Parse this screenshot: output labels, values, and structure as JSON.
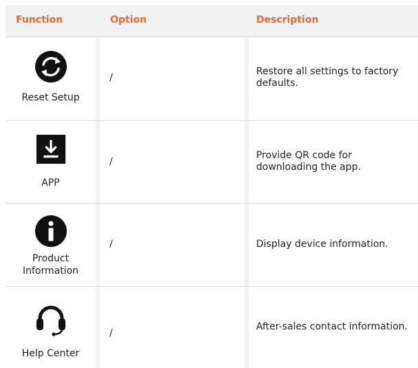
{
  "header": {
    "function": "Function",
    "option": "Option",
    "description": "Description"
  },
  "rows": [
    {
      "function": "Reset Setup",
      "option": "/",
      "description": "Restore all settings to factory defaults.",
      "icon": "reset-icon"
    },
    {
      "function": "APP",
      "option": "/",
      "description": "Provide QR code for downloading the app.",
      "icon": "download-icon"
    },
    {
      "function": "Product Information",
      "option": "/",
      "description": "Display device information.",
      "icon": "info-icon"
    },
    {
      "function": "Help Center",
      "option": "/",
      "description": "After-sales contact information.",
      "icon": "headset-icon"
    }
  ],
  "colors": {
    "header_text": "#ec6a2c",
    "header_bg": "#f2f2f2",
    "icon": "#111111"
  }
}
